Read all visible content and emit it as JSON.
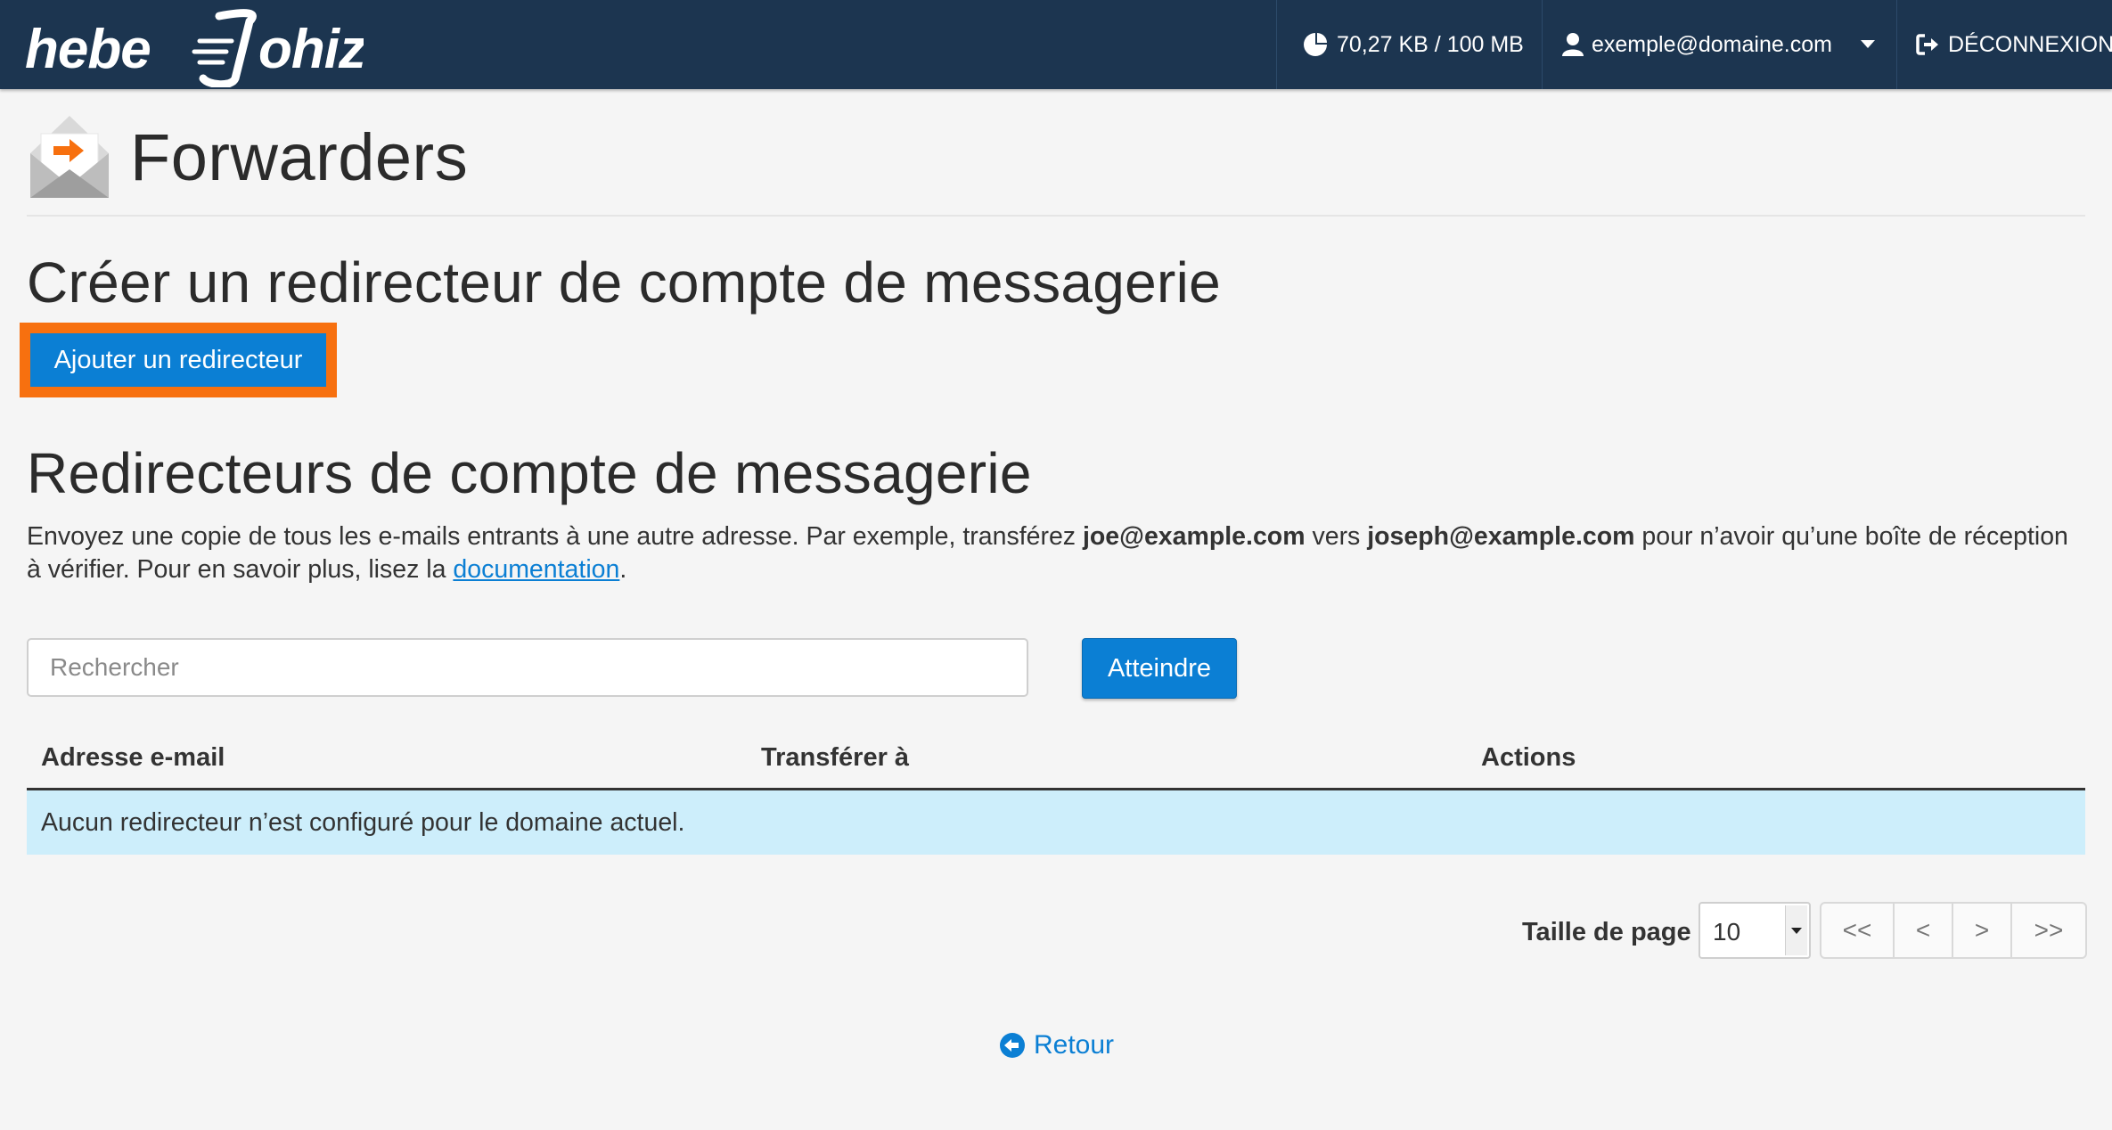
{
  "header": {
    "logo_text": "hebergeur-Johiz",
    "quota": "70,27 KB / 100 MB",
    "user_email": "exemple@domaine.com",
    "logout_label": "DÉCONNEXION"
  },
  "page": {
    "title": "Forwarders"
  },
  "create_section": {
    "title": "Créer un redirecteur de compte de messagerie",
    "add_button": "Ajouter un redirecteur"
  },
  "list_section": {
    "title": "Redirecteurs de compte de messagerie",
    "desc_1": "Envoyez une copie de tous les e-mails entrants à une autre adresse. Par exemple, transférez ",
    "desc_email_1": "joe@example.com",
    "desc_2": " vers ",
    "desc_email_2": "joseph@example.com",
    "desc_3": " pour n’avoir qu’une boîte de réception à vérifier. Pour en savoir plus, lisez la ",
    "desc_link": "documentation",
    "desc_4": "."
  },
  "search": {
    "placeholder": "Rechercher",
    "value": "",
    "go_button": "Atteindre"
  },
  "table": {
    "columns": [
      "Adresse e-mail",
      "Transférer à",
      "Actions"
    ],
    "empty_message": "Aucun redirecteur n’est configuré pour le domaine actuel."
  },
  "pagination": {
    "label": "Taille de page",
    "page_size": "10",
    "first": "<<",
    "prev": "<",
    "next": ">",
    "last": ">>"
  },
  "footer": {
    "back_label": "Retour"
  },
  "colors": {
    "topbar": "#1c3550",
    "primary": "#0b7fd4",
    "highlight": "#f7700f",
    "info_row": "#cdeefb"
  }
}
